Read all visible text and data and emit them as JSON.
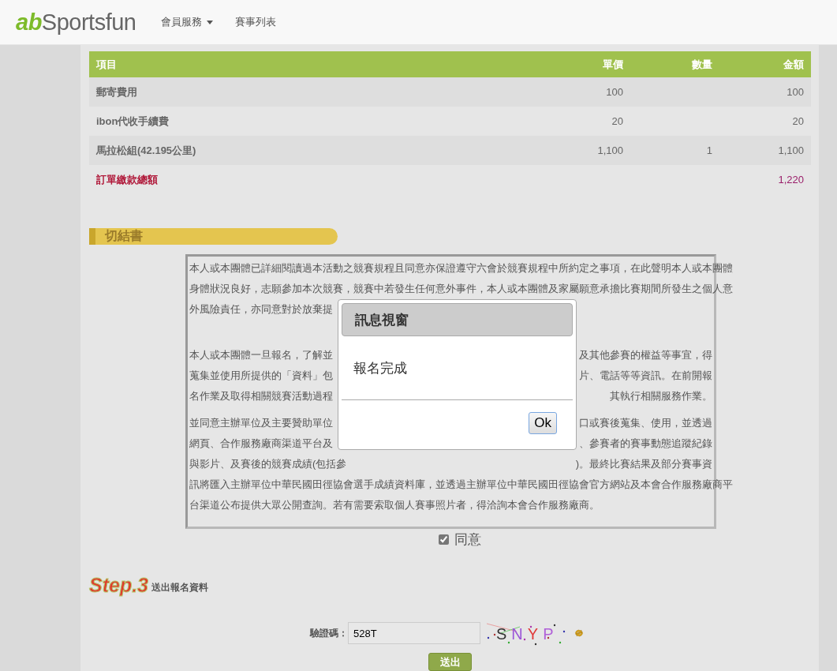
{
  "navbar": {
    "logo_accent": "ab",
    "logo_text": "Sportsfun",
    "menu": [
      {
        "label": "會員服務",
        "kind": "dropdown"
      },
      {
        "label": "賽事列表",
        "kind": "link"
      }
    ]
  },
  "order_table": {
    "columns": [
      "項目",
      "單價",
      "數量",
      "金額"
    ],
    "rows": [
      {
        "cells": [
          "郵寄費用",
          "100",
          "",
          "100"
        ]
      },
      {
        "cells": [
          "ibon代收手續費",
          "20",
          "",
          "20"
        ]
      },
      {
        "cells": [
          "馬拉松組(42.195公里)",
          "1,100",
          "1",
          "1,100"
        ]
      }
    ],
    "total": {
      "label": "訂單繳款總額",
      "amount": "1,220"
    }
  },
  "waiver": {
    "title": "切結書",
    "paragraphs": [
      {
        "lines": [
          {
            "left": "本人或本團體已詳細閱讀過本活動之競賽規程且同意亦保證遵守六會於競賽規程中所約定之事項，在此聲明本人或本團體"
          },
          {
            "left": "身體狀況良好，志願參加本次競賽，競賽中若發生任何意外事件，本人或本團體及家屬願意承擔比賽期間所發生之個人意"
          },
          {
            "left": "外風險責任，亦同意對於放棄提"
          }
        ]
      },
      {
        "lines": [
          {
            "left": "本人或本團體一旦報名，了解並",
            "right": "及其他參賽的權益等事宜，得"
          },
          {
            "left": "蒐集並使用所提供的「資料」包",
            "right": "片、電話等等資訊。在前開報"
          },
          {
            "left": "名作業及取得相關競賽活動過程",
            "right": "其執行相關服務作業。"
          }
        ]
      },
      {
        "lines": [
          {
            "left": "並同意主辦單位及主要贊助單位",
            "right": "口或賽後蒐集、使用，並透過"
          },
          {
            "left": "網頁、合作服務廠商渠道平台及",
            "right": "、參賽者的賽事動態追蹤紀錄"
          },
          {
            "left": "與影片、及賽後的競賽成績(包括參",
            "right": ")。最終比賽結果及部分賽事資"
          },
          {
            "left": "訊將匯入主辦單位中華民國田徑協會選手成績資料庫，並透過主辦單位中華民國田徑協會官方網站及本會合作服務廠商平"
          },
          {
            "left": "台渠道公布提供大眾公開查詢。若有需要索取個人賽事照片者，得洽詢本會合作服務廠商。"
          }
        ]
      }
    ],
    "agree": {
      "label": "同意",
      "checked": true
    }
  },
  "step": {
    "number": "Step.3",
    "title": "送出報名資料"
  },
  "captcha": {
    "label": "驗證碼：",
    "value": "528T",
    "image_text": "SNYP"
  },
  "submit_button": "送出",
  "dialog": {
    "title": "訊息視窗",
    "message": "報名完成",
    "button": "Ok"
  }
}
